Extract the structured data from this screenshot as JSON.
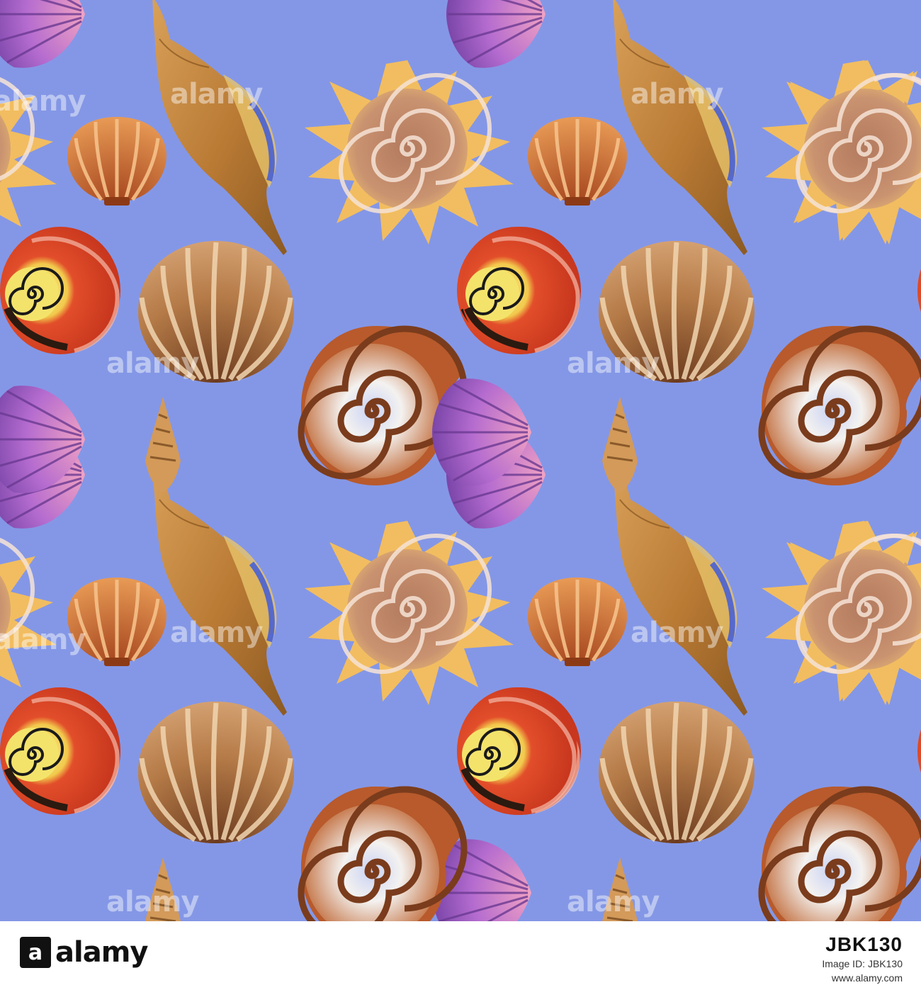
{
  "image": {
    "description_colors": {
      "background": "#8497E6",
      "conch": "#C98A3F",
      "scallop_brown": "#B5763E",
      "snail_red": "#E24E2A",
      "snail_yellow": "#F4E36B",
      "pink_shell": "#B36BC9",
      "spiky_shell": "#F0B95A",
      "spiral_brown": "#8A4A2A",
      "spiral_white": "#EEF0FA"
    },
    "watermark_text": "alamy"
  },
  "footer": {
    "logo_mark": "a",
    "logo_word": "alamy",
    "image_id_label": "Image ID: JBK130",
    "site": "www.alamy.com",
    "code": "JBK130"
  }
}
